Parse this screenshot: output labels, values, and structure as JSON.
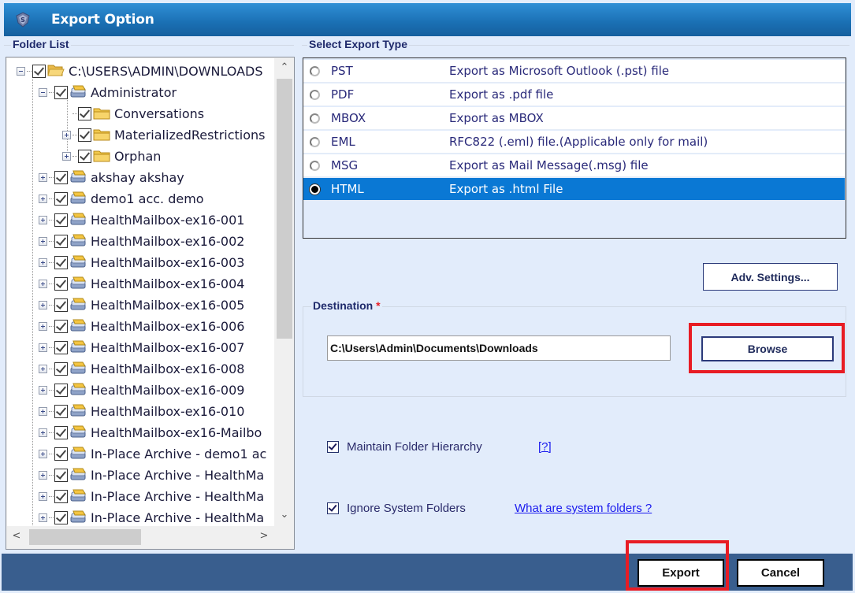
{
  "window": {
    "title": "Export Option",
    "icon": "shield-app-icon"
  },
  "folder_list": {
    "label": "Folder List",
    "root": {
      "label": "C:\\USERS\\ADMIN\\DOWNLOADS",
      "checked": true,
      "expanded": true,
      "icon": "folder-open-icon"
    },
    "nodes": [
      {
        "label": "Administrator",
        "level": 1,
        "expander": "minus",
        "checked": true,
        "icon": "mailbox-icon"
      },
      {
        "label": "Conversations",
        "level": 2,
        "expander": "none",
        "checked": true,
        "icon": "folder-icon"
      },
      {
        "label": "MaterializedRestrictions",
        "level": 2,
        "expander": "plus",
        "checked": true,
        "icon": "folder-icon"
      },
      {
        "label": "Orphan",
        "level": 2,
        "expander": "plus",
        "checked": true,
        "icon": "folder-icon"
      },
      {
        "label": "akshay akshay",
        "level": 1,
        "expander": "plus",
        "checked": true,
        "icon": "mailbox-icon"
      },
      {
        "label": "demo1 acc. demo",
        "level": 1,
        "expander": "plus",
        "checked": true,
        "icon": "mailbox-icon"
      },
      {
        "label": "HealthMailbox-ex16-001",
        "level": 1,
        "expander": "plus",
        "checked": true,
        "icon": "mailbox-icon"
      },
      {
        "label": "HealthMailbox-ex16-002",
        "level": 1,
        "expander": "plus",
        "checked": true,
        "icon": "mailbox-icon"
      },
      {
        "label": "HealthMailbox-ex16-003",
        "level": 1,
        "expander": "plus",
        "checked": true,
        "icon": "mailbox-icon"
      },
      {
        "label": "HealthMailbox-ex16-004",
        "level": 1,
        "expander": "plus",
        "checked": true,
        "icon": "mailbox-icon"
      },
      {
        "label": "HealthMailbox-ex16-005",
        "level": 1,
        "expander": "plus",
        "checked": true,
        "icon": "mailbox-icon"
      },
      {
        "label": "HealthMailbox-ex16-006",
        "level": 1,
        "expander": "plus",
        "checked": true,
        "icon": "mailbox-icon"
      },
      {
        "label": "HealthMailbox-ex16-007",
        "level": 1,
        "expander": "plus",
        "checked": true,
        "icon": "mailbox-icon"
      },
      {
        "label": "HealthMailbox-ex16-008",
        "level": 1,
        "expander": "plus",
        "checked": true,
        "icon": "mailbox-icon"
      },
      {
        "label": "HealthMailbox-ex16-009",
        "level": 1,
        "expander": "plus",
        "checked": true,
        "icon": "mailbox-icon"
      },
      {
        "label": "HealthMailbox-ex16-010",
        "level": 1,
        "expander": "plus",
        "checked": true,
        "icon": "mailbox-icon"
      },
      {
        "label": "HealthMailbox-ex16-Mailbo",
        "level": 1,
        "expander": "plus",
        "checked": true,
        "icon": "mailbox-icon"
      },
      {
        "label": "In-Place Archive - demo1 ac",
        "level": 1,
        "expander": "plus",
        "checked": true,
        "icon": "mailbox-icon"
      },
      {
        "label": "In-Place Archive - HealthMa",
        "level": 1,
        "expander": "plus",
        "checked": true,
        "icon": "mailbox-icon"
      },
      {
        "label": "In-Place Archive - HealthMa",
        "level": 1,
        "expander": "plus",
        "checked": true,
        "icon": "mailbox-icon"
      },
      {
        "label": "In-Place Archive - HealthMa",
        "level": 1,
        "expander": "plus",
        "checked": true,
        "icon": "mailbox-icon"
      }
    ],
    "scroll_up": "⌃",
    "scroll_down": "⌄",
    "scroll_left": "<",
    "scroll_right": ">"
  },
  "export_type": {
    "label": "Select Export Type",
    "selected": "HTML",
    "options": [
      {
        "name": "PST",
        "desc": "Export as Microsoft Outlook (.pst) file"
      },
      {
        "name": "PDF",
        "desc": "Export as .pdf file"
      },
      {
        "name": "MBOX",
        "desc": "Export as MBOX"
      },
      {
        "name": "EML",
        "desc": "RFC822 (.eml) file.(Applicable only for mail)"
      },
      {
        "name": "MSG",
        "desc": "Export as Mail Message(.msg) file"
      },
      {
        "name": "HTML",
        "desc": "Export as .html File"
      }
    ]
  },
  "adv_settings_label": "Adv. Settings...",
  "destination": {
    "label": "Destination",
    "required_mark": "*",
    "path": "C:\\Users\\Admin\\Documents\\Downloads",
    "browse_label": "Browse"
  },
  "options": {
    "maintain_hierarchy": {
      "label": "Maintain Folder Hierarchy",
      "checked": true,
      "help": "[?]"
    },
    "ignore_system": {
      "label": "Ignore System Folders",
      "checked": true,
      "help": "What are system folders ?"
    }
  },
  "footer": {
    "export_label": "Export",
    "cancel_label": "Cancel"
  },
  "colors": {
    "titlebar": "#1a6fb3",
    "selection": "#0a78d4",
    "footer": "#395e8e",
    "highlight_box": "#e81c24",
    "panel_bg": "#e2ecfb"
  }
}
